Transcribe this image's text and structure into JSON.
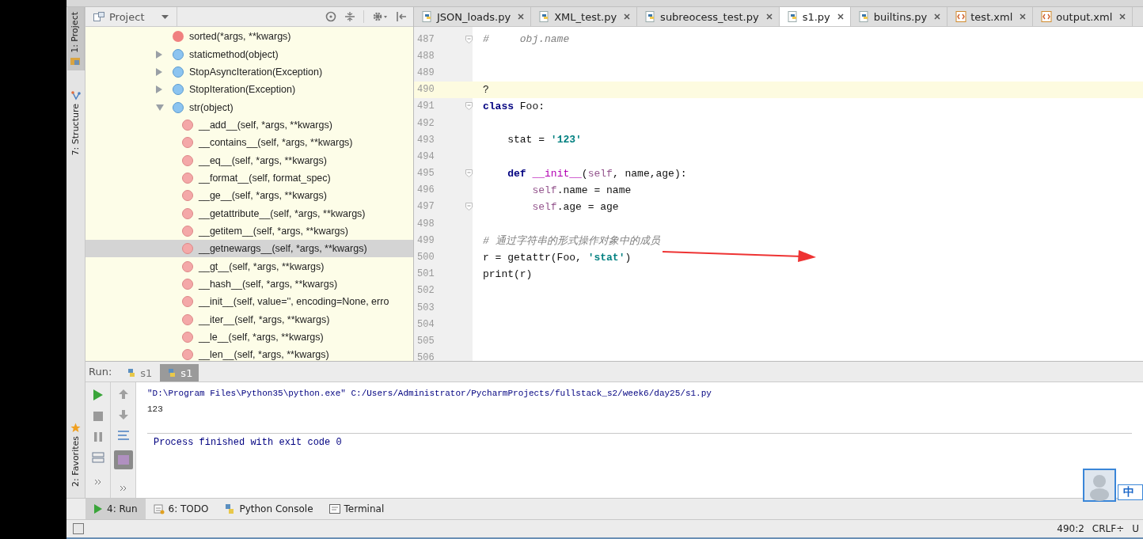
{
  "side_stripe": [
    {
      "label": "1: Project",
      "kind": "project",
      "selected": true
    },
    {
      "label": "7: Structure",
      "kind": "structure",
      "selected": false
    },
    {
      "label": "2: Favorites",
      "kind": "favorites",
      "selected": false
    }
  ],
  "project_panel": {
    "title": "Project",
    "tree": [
      {
        "label": "sorted(*args, **kwargs)",
        "kind": "function",
        "selected": false
      },
      {
        "label": "staticmethod(object)",
        "kind": "class",
        "expanded": false,
        "selected": false
      },
      {
        "label": "StopAsyncIteration(Exception)",
        "kind": "class",
        "expanded": false,
        "selected": false
      },
      {
        "label": "StopIteration(Exception)",
        "kind": "class",
        "expanded": false,
        "selected": false
      },
      {
        "label": "str(object)",
        "kind": "class",
        "expanded": true,
        "selected": false,
        "children": [
          {
            "label": "__add__(self, *args, **kwargs)",
            "kind": "method",
            "selected": false
          },
          {
            "label": "__contains__(self, *args, **kwargs)",
            "kind": "method",
            "selected": false
          },
          {
            "label": "__eq__(self, *args, **kwargs)",
            "kind": "method",
            "selected": false
          },
          {
            "label": "__format__(self, format_spec)",
            "kind": "method",
            "selected": false
          },
          {
            "label": "__ge__(self, *args, **kwargs)",
            "kind": "method",
            "selected": false
          },
          {
            "label": "__getattribute__(self, *args, **kwargs)",
            "kind": "method",
            "selected": false
          },
          {
            "label": "__getitem__(self, *args, **kwargs)",
            "kind": "method",
            "selected": false
          },
          {
            "label": "__getnewargs__(self, *args, **kwargs)",
            "kind": "method",
            "selected": true
          },
          {
            "label": "__gt__(self, *args, **kwargs)",
            "kind": "method",
            "selected": false
          },
          {
            "label": "__hash__(self, *args, **kwargs)",
            "kind": "method",
            "selected": false
          },
          {
            "label": "__init__(self, value='', encoding=None, erro",
            "kind": "method",
            "selected": false
          },
          {
            "label": "__iter__(self, *args, **kwargs)",
            "kind": "method",
            "selected": false
          },
          {
            "label": "__le__(self, *args, **kwargs)",
            "kind": "method",
            "selected": false
          },
          {
            "label": "__len__(self, *args, **kwargs)",
            "kind": "method",
            "selected": false
          }
        ]
      }
    ]
  },
  "editor_tabs": [
    {
      "label": "JSON_loads.py",
      "kind": "python",
      "selected": false
    },
    {
      "label": "XML_test.py",
      "kind": "python",
      "selected": false
    },
    {
      "label": "subreocess_test.py",
      "kind": "python",
      "selected": false
    },
    {
      "label": "s1.py",
      "kind": "python",
      "selected": true
    },
    {
      "label": "builtins.py",
      "kind": "python",
      "selected": false
    },
    {
      "label": "test.xml",
      "kind": "xml",
      "selected": false
    },
    {
      "label": "output.xml",
      "kind": "xml",
      "selected": false
    }
  ],
  "code_lines": [
    {
      "number": "487",
      "fold_marker": true,
      "current": false,
      "tokens": [
        {
          "kind": "comment",
          "text": "#     obj.name"
        }
      ]
    },
    {
      "number": "488",
      "fold_marker": false,
      "current": false
    },
    {
      "number": "489",
      "fold_marker": false,
      "current": false
    },
    {
      "number": "490",
      "fold_marker": false,
      "current": true,
      "tokens": [
        {
          "kind": "plain",
          "text": "?"
        }
      ]
    },
    {
      "number": "491",
      "fold_marker": true,
      "current": false,
      "tokens": [
        {
          "kind": "keyword",
          "text": "class"
        },
        {
          "kind": "plain",
          "text": " Foo:"
        }
      ]
    },
    {
      "number": "492",
      "fold_marker": false,
      "current": false
    },
    {
      "number": "493",
      "fold_marker": false,
      "current": false,
      "tokens": [
        {
          "kind": "plain",
          "text": "    stat = "
        },
        {
          "kind": "string",
          "text": "'123'"
        }
      ]
    },
    {
      "number": "494",
      "fold_marker": false,
      "current": false
    },
    {
      "number": "495",
      "fold_marker": true,
      "current": false,
      "tokens": [
        {
          "kind": "keyword",
          "text": "    def "
        },
        {
          "kind": "magic",
          "text": "__init__"
        },
        {
          "kind": "plain",
          "text": "("
        },
        {
          "kind": "self",
          "text": "self"
        },
        {
          "kind": "plain",
          "text": ", name,age):"
        }
      ]
    },
    {
      "number": "496",
      "fold_marker": false,
      "current": false,
      "tokens": [
        {
          "kind": "self",
          "text": "        self"
        },
        {
          "kind": "plain",
          "text": ".name = name"
        }
      ]
    },
    {
      "number": "497",
      "fold_marker": true,
      "current": false,
      "tokens": [
        {
          "kind": "self",
          "text": "        self"
        },
        {
          "kind": "plain",
          "text": ".age = age"
        }
      ]
    },
    {
      "number": "498",
      "fold_marker": false,
      "current": false
    },
    {
      "number": "499",
      "fold_marker": false,
      "current": false,
      "tokens": [
        {
          "kind": "comment",
          "text": "# 通过字符串的形式操作对象中的成员"
        }
      ]
    },
    {
      "number": "500",
      "fold_marker": false,
      "current": false,
      "tokens": [
        {
          "kind": "plain",
          "text": "r = getattr(Foo, "
        },
        {
          "kind": "string",
          "text": "'stat'"
        },
        {
          "kind": "plain",
          "text": ")"
        }
      ]
    },
    {
      "number": "501",
      "fold_marker": false,
      "current": false,
      "tokens": [
        {
          "kind": "plain",
          "text": "print(r)"
        }
      ]
    },
    {
      "number": "502",
      "fold_marker": false,
      "current": false
    },
    {
      "number": "503",
      "fold_marker": false,
      "current": false
    },
    {
      "number": "504",
      "fold_marker": false,
      "current": false
    },
    {
      "number": "505",
      "fold_marker": false,
      "current": false
    },
    {
      "number": "506",
      "fold_marker": false,
      "current": false
    }
  ],
  "run_panel": {
    "label": "Run:",
    "tabs": [
      {
        "label": "s1",
        "selected": false
      },
      {
        "label": "s1",
        "selected": true
      }
    ],
    "console": [
      {
        "kind": "command",
        "text": "\"D:\\Program Files\\Python35\\python.exe\" C:/Users/Administrator/PycharmProjects/fullstack_s2/week6/day25/s1.py"
      },
      {
        "kind": "output",
        "text": "123"
      },
      {
        "kind": "status",
        "text": "Process finished with exit code 0"
      }
    ]
  },
  "tool_tabs": [
    {
      "label": "4: Run",
      "kind": "run",
      "selected": true
    },
    {
      "label": "6: TODO",
      "kind": "todo",
      "selected": false
    },
    {
      "label": "Python Console",
      "kind": "console",
      "selected": false
    },
    {
      "label": "Terminal",
      "kind": "terminal",
      "selected": false
    }
  ],
  "ime_widget": {
    "label": "中"
  },
  "status_bar": {
    "position": "490:2",
    "line_separator": "CRLF÷",
    "encoding": "U"
  }
}
